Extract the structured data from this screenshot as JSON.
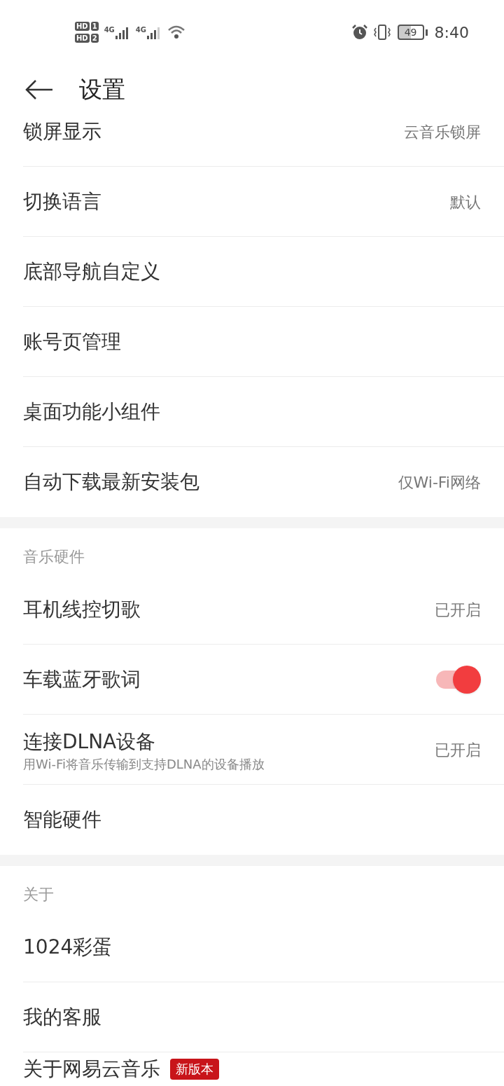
{
  "status_bar": {
    "sims": [
      {
        "label": "HD",
        "slot": "1"
      },
      {
        "label": "HD",
        "slot": "2"
      }
    ],
    "networks": [
      "4G",
      "4G"
    ],
    "battery": "49",
    "time": "8:40"
  },
  "header": {
    "title": "设置"
  },
  "sections": [
    {
      "items": [
        {
          "kind": "value",
          "label": "锁屏显示",
          "value": "云音乐锁屏"
        },
        {
          "kind": "value",
          "label": "切换语言",
          "value": "默认"
        },
        {
          "kind": "plain",
          "label": "底部导航自定义"
        },
        {
          "kind": "plain",
          "label": "账号页管理"
        },
        {
          "kind": "plain",
          "label": "桌面功能小组件"
        },
        {
          "kind": "value",
          "label": "自动下载最新安装包",
          "value": "仅Wi-Fi网络"
        }
      ]
    },
    {
      "title": "音乐硬件",
      "items": [
        {
          "kind": "value",
          "label": "耳机线控切歌",
          "value": "已开启"
        },
        {
          "kind": "toggle",
          "label": "车载蓝牙歌词",
          "on": true
        },
        {
          "kind": "value",
          "label": "连接DLNA设备",
          "subtitle": "用Wi-Fi将音乐传输到支持DLNA的设备播放",
          "value": "已开启"
        },
        {
          "kind": "plain",
          "label": "智能硬件"
        }
      ]
    },
    {
      "title": "关于",
      "items": [
        {
          "kind": "plain",
          "label": "1024彩蛋"
        },
        {
          "kind": "plain",
          "label": "我的客服"
        },
        {
          "kind": "plain",
          "label": "关于网易云音乐",
          "badge": "新版本"
        }
      ]
    }
  ]
}
